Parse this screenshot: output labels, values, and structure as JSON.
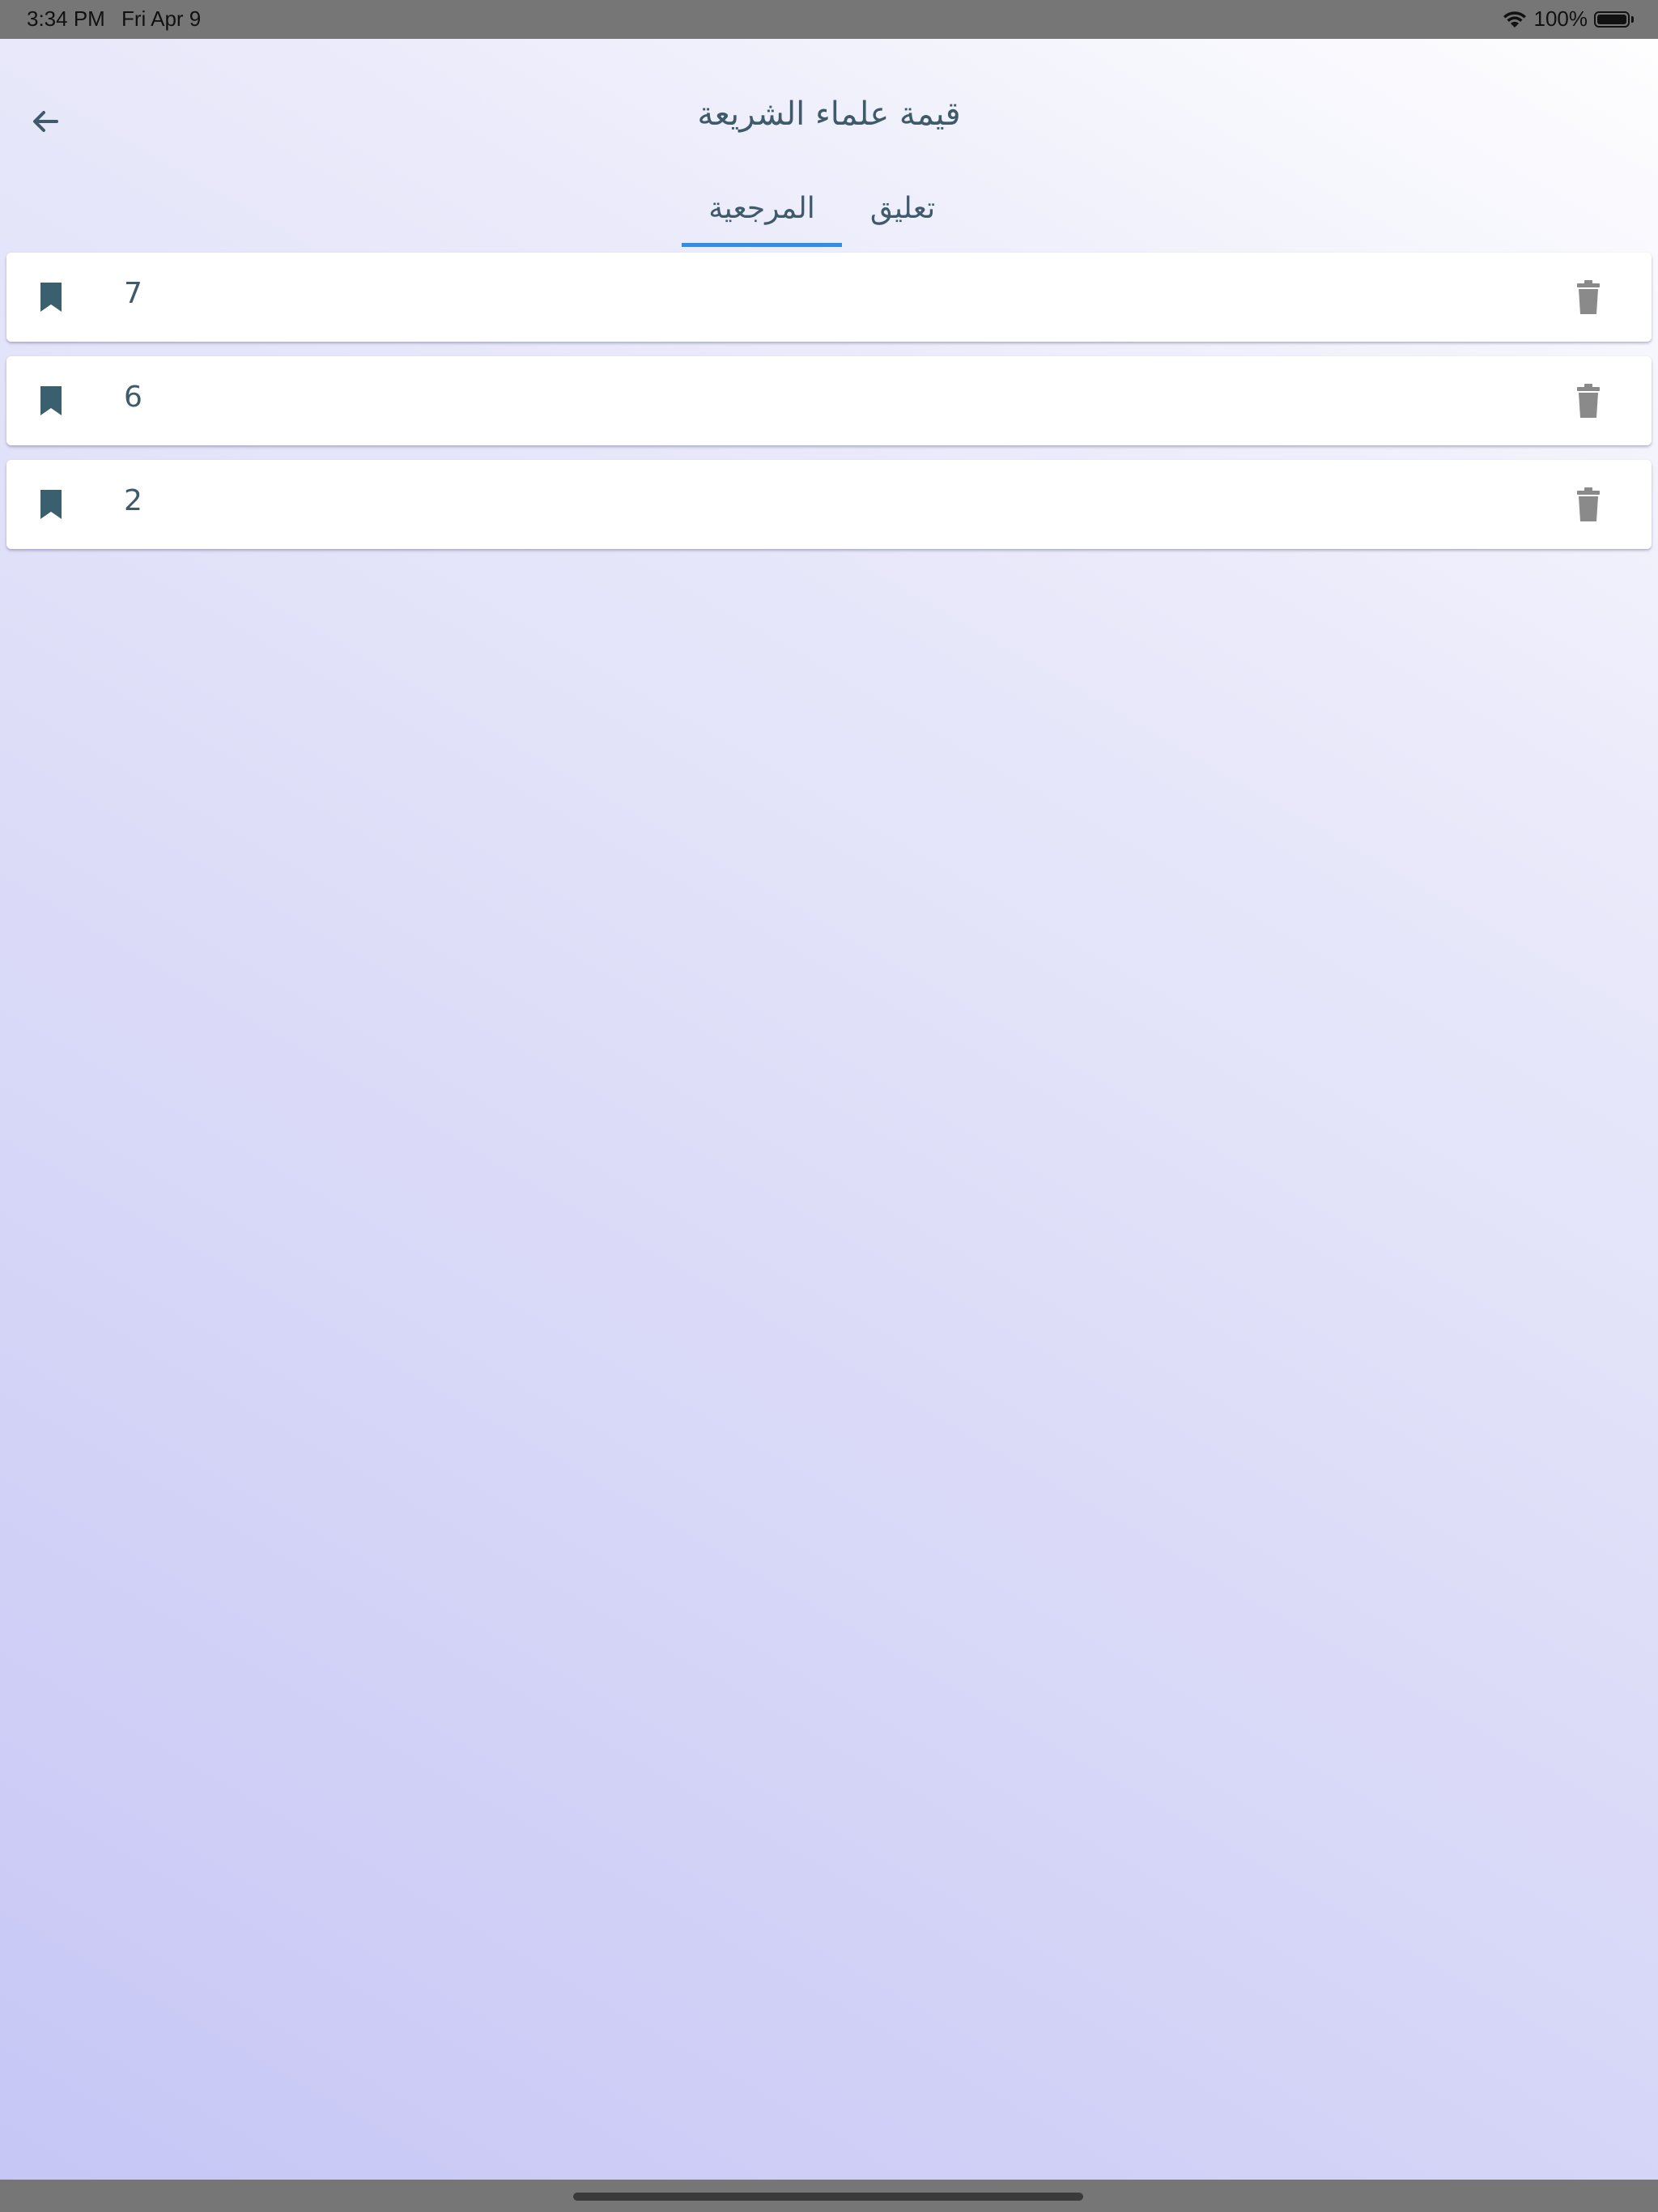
{
  "status_bar": {
    "time": "3:34 PM",
    "date": "Fri Apr 9",
    "battery": "100%",
    "battery_level": 1.0
  },
  "header": {
    "title": "قيمة علماء الشريعة",
    "back_icon": "arrow-left-icon"
  },
  "tabs": [
    {
      "label": "المرجعية",
      "selected": true
    },
    {
      "label": "تعليق",
      "selected": false
    }
  ],
  "colors": {
    "accent": "#2f8fe6",
    "text": "#3e5a6b",
    "icon_bookmark": "#3a5f6e",
    "icon_delete": "#8a8a8a"
  },
  "bookmarks": [
    {
      "number": "7",
      "icon": "bookmark-icon",
      "action_icon": "trash-icon"
    },
    {
      "number": "6",
      "icon": "bookmark-icon",
      "action_icon": "trash-icon"
    },
    {
      "number": "2",
      "icon": "bookmark-icon",
      "action_icon": "trash-icon"
    }
  ]
}
